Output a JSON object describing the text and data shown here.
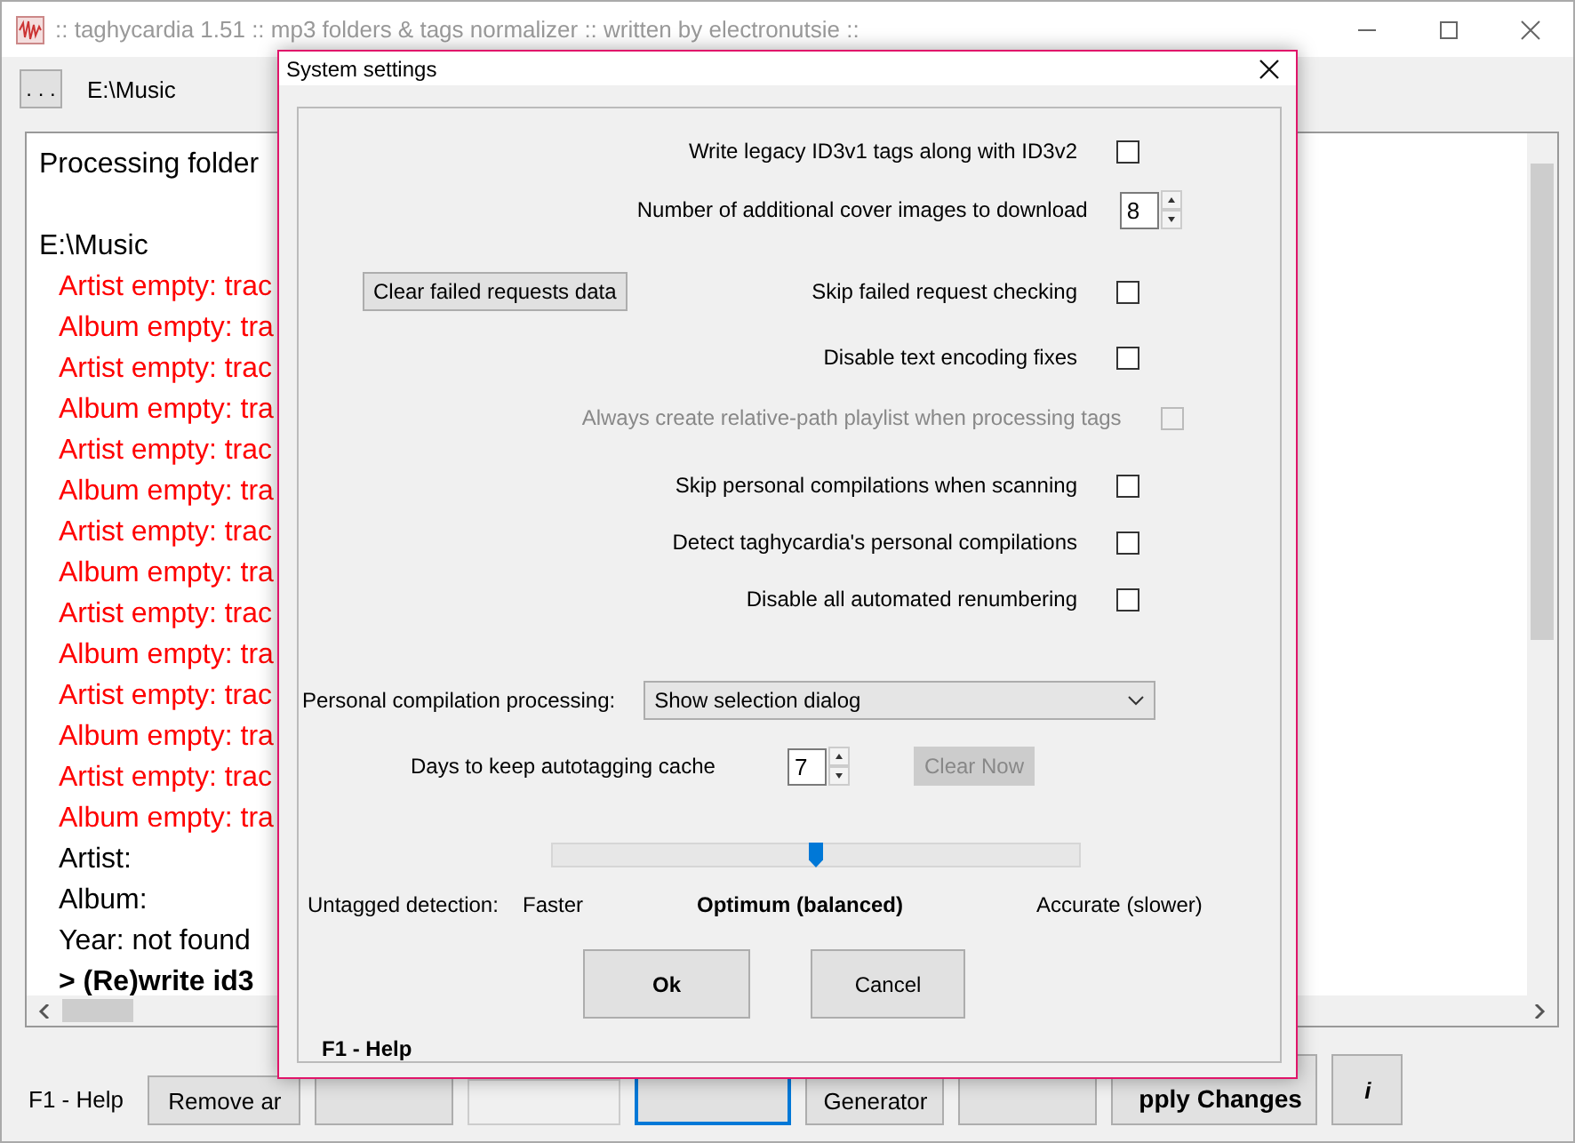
{
  "window": {
    "title": ":: taghycardia 1.51 :: mp3 folders & tags normalizer :: written by electronutsie ::"
  },
  "path_bar": {
    "browse_button": ". . .",
    "path": "E:\\Music"
  },
  "log": [
    {
      "kind": "plain",
      "text": "Processing folder"
    },
    {
      "kind": "blank"
    },
    {
      "kind": "plain",
      "text": "E:\\Music"
    },
    {
      "kind": "error",
      "text": "Artist empty: trac"
    },
    {
      "kind": "error",
      "text": "Album empty: tra"
    },
    {
      "kind": "error",
      "text": "Artist empty: trac"
    },
    {
      "kind": "error",
      "text": "Album empty: tra"
    },
    {
      "kind": "error",
      "text": "Artist empty: trac"
    },
    {
      "kind": "error",
      "text": "Album empty: tra"
    },
    {
      "kind": "error",
      "text": "Artist empty: trac"
    },
    {
      "kind": "error",
      "text": "Album empty: tra"
    },
    {
      "kind": "error",
      "text": "Artist empty: trac"
    },
    {
      "kind": "error",
      "text": "Album empty: tra"
    },
    {
      "kind": "error",
      "text": "Artist empty: trac"
    },
    {
      "kind": "error",
      "text": "Album empty: tra"
    },
    {
      "kind": "error",
      "text": "Artist empty: trac"
    },
    {
      "kind": "error",
      "text": "Album empty: tra"
    },
    {
      "kind": "item",
      "text": "Artist:"
    },
    {
      "kind": "item",
      "text": "Album:"
    },
    {
      "kind": "item",
      "text": "Year: not found"
    },
    {
      "kind": "bold",
      "text": "> (Re)write id3"
    }
  ],
  "bottom_bar": {
    "help": "F1 - Help",
    "buttons": [
      {
        "kind": "button",
        "label": "Remove ar"
      },
      {
        "kind": "button"
      },
      {
        "kind": "field"
      },
      {
        "kind": "focused"
      },
      {
        "kind": "button",
        "label": "Generator"
      },
      {
        "kind": "button"
      },
      {
        "kind": "bold",
        "label": "pply Changes"
      },
      {
        "kind": "italic",
        "label": "i"
      }
    ]
  },
  "dialog": {
    "title": "System settings",
    "settings": [
      {
        "kind": "checkbox",
        "label": "Write legacy ID3v1 tags along with ID3v2",
        "checked": false,
        "disabled": false
      },
      {
        "kind": "spinner",
        "label": "Number of additional cover images to download",
        "value": "8"
      },
      {
        "kind": "checkbox",
        "label": "Skip failed request checking",
        "checked": false,
        "disabled": false,
        "button": "Clear failed requests data"
      },
      {
        "kind": "checkbox",
        "label": "Disable text encoding fixes",
        "checked": false,
        "disabled": false
      },
      {
        "kind": "checkbox",
        "label": "Always create relative-path playlist when processing tags",
        "checked": false,
        "disabled": true
      },
      {
        "kind": "checkbox",
        "label": "Skip personal compilations when scanning",
        "checked": false,
        "disabled": false
      },
      {
        "kind": "checkbox",
        "label": "Detect taghycardia's personal compilations",
        "checked": false,
        "disabled": false
      },
      {
        "kind": "checkbox",
        "label": "Disable all automated renumbering",
        "checked": false,
        "disabled": false
      }
    ],
    "compilation": {
      "label": "Personal compilation processing:",
      "value": "Show selection dialog"
    },
    "cache": {
      "label": "Days to keep autotagging cache",
      "value": "7",
      "button": "Clear Now",
      "button_disabled": true
    },
    "detection": {
      "label": "Untagged detection:",
      "level": 0.5,
      "stops": [
        {
          "label": "Faster",
          "selected": false
        },
        {
          "label": "Optimum (balanced)",
          "selected": true
        },
        {
          "label": "Accurate (slower)",
          "selected": false
        }
      ]
    },
    "buttons": [
      {
        "label": "Ok",
        "default": true
      },
      {
        "label": "Cancel",
        "default": false
      }
    ],
    "help": "F1 - Help"
  }
}
